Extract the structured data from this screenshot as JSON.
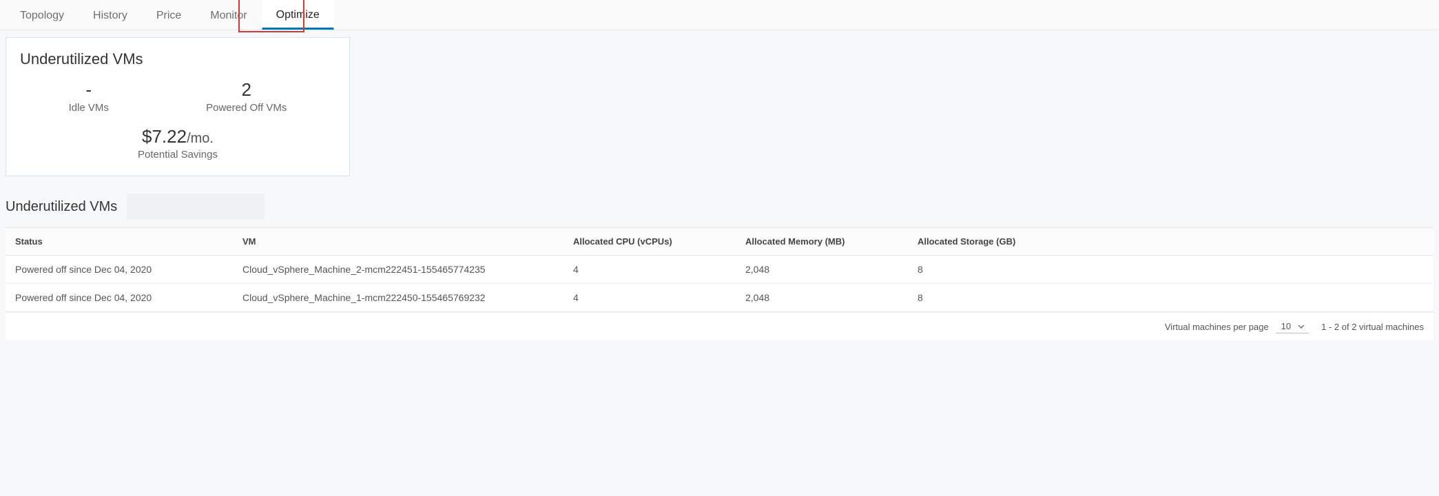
{
  "tabs": {
    "topology": "Topology",
    "history": "History",
    "price": "Price",
    "monitor": "Monitor",
    "optimize": "Optimize"
  },
  "card": {
    "title": "Underutilized VMs",
    "idle_value": "-",
    "idle_label": "Idle VMs",
    "poweredoff_value": "2",
    "poweredoff_label": "Powered Off VMs",
    "savings_value": "$7.22",
    "savings_unit": "/mo.",
    "savings_label": "Potential Savings"
  },
  "section": {
    "heading": "Underutilized VMs"
  },
  "table": {
    "headers": {
      "status": "Status",
      "vm": "VM",
      "cpu": "Allocated CPU (vCPUs)",
      "memory": "Allocated Memory (MB)",
      "storage": "Allocated Storage (GB)"
    },
    "rows": [
      {
        "status": "Powered off since Dec 04, 2020",
        "vm": "Cloud_vSphere_Machine_2-mcm222451-155465774235",
        "cpu": "4",
        "memory": "2,048",
        "storage": "8"
      },
      {
        "status": "Powered off since Dec 04, 2020",
        "vm": "Cloud_vSphere_Machine_1-mcm222450-155465769232",
        "cpu": "4",
        "memory": "2,048",
        "storage": "8"
      }
    ]
  },
  "footer": {
    "per_page_label": "Virtual machines per page",
    "per_page_value": "10",
    "range_text": "1 - 2 of 2 virtual machines"
  }
}
